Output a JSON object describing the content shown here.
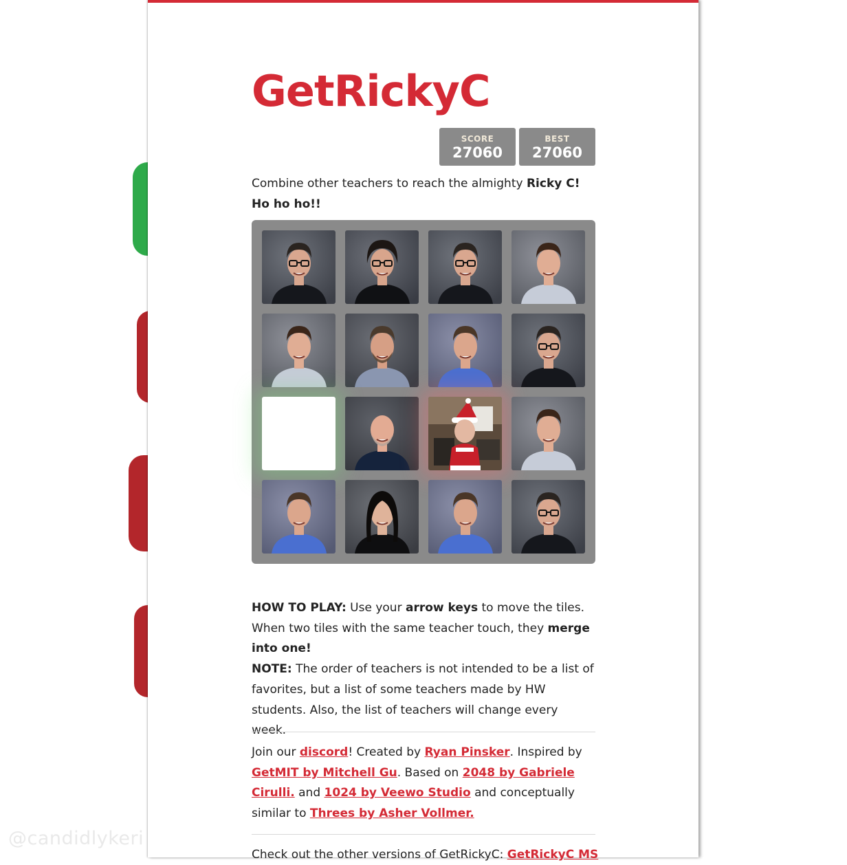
{
  "watermark": "@candidlykeri",
  "title": "GetRickyC",
  "score": {
    "label": "SCORE",
    "value": "27060"
  },
  "best": {
    "label": "BEST",
    "value": "27060"
  },
  "intro": {
    "text": "Combine other teachers to reach the almighty ",
    "bold": "Ricky C! Ho ho ho!!"
  },
  "board": {
    "rows": [
      [
        "teacher-glasses",
        "teacher-woman-glasses",
        "teacher-glasses",
        "teacher-young-checkered"
      ],
      [
        "teacher-young-checkered",
        "teacher-beard",
        "teacher-blue-shirt",
        "teacher-glasses"
      ],
      [
        "empty",
        "teacher-bald",
        "ricky-c-santa",
        "teacher-young-checkered"
      ],
      [
        "teacher-blue-shirt",
        "teacher-woman-dark-hair",
        "teacher-blue-shirt",
        "teacher-glasses"
      ]
    ]
  },
  "howto": {
    "label": "HOW TO PLAY:",
    "t1": " Use your ",
    "b1": "arrow keys",
    "t2": " to move the tiles. When two tiles with the same teacher touch, they ",
    "b2": "merge into one!"
  },
  "note": {
    "label": "NOTE:",
    "text": " The order of teachers is not intended to be a list of favorites, but a list of some teachers made by HW students. Also, the list of teachers will change every week."
  },
  "credits": {
    "t1": "Join our ",
    "discord": "discord",
    "t2": "! Created by ",
    "author": "Ryan Pinsker",
    "t3": ". Inspired by ",
    "getmit": "GetMIT by Mitchell Gu",
    "t4": ". Based on ",
    "g2048": "2048 by Gabriele Cirulli.",
    "t5": " and ",
    "g1024": "1024 by Veewo Studio",
    "t6": " and conceptually similar to ",
    "threes": "Threes by Asher Vollmer."
  },
  "more": {
    "text": "Check out the other versions of GetRickyC: ",
    "link": "GetRickyC MS"
  },
  "colors": {
    "accent": "#d42a35",
    "board": "#8a8a8a",
    "tile_empty": "#ffffff"
  }
}
